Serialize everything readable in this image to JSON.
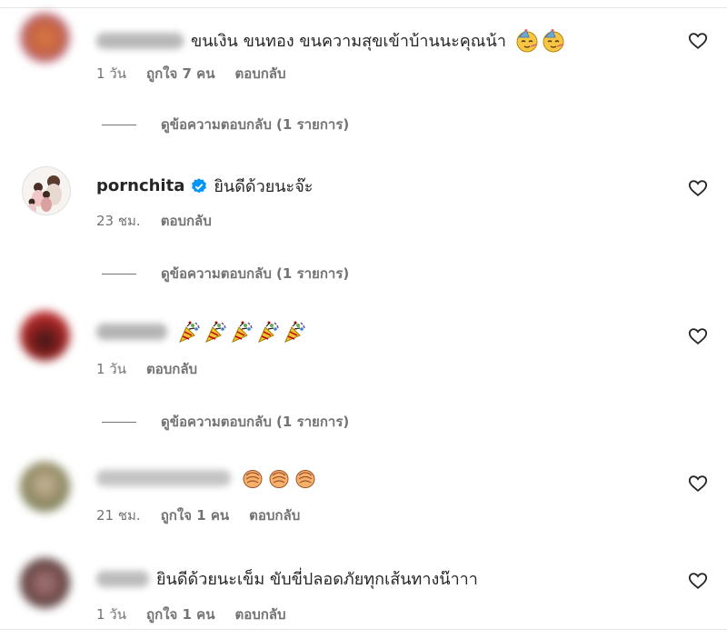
{
  "comments": [
    {
      "username": "",
      "username_hidden": true,
      "text": "ขนเงิน ขนทอง ขนความสุขเข้าบ้านนะคุณน้า",
      "emojis": [
        "face-with-party-hat-emoji",
        "face-with-party-hat-emoji"
      ],
      "time": "1 วัน",
      "likes": "ถูกใจ 7 คน",
      "reply": "ตอบกลับ",
      "view_replies": "ดูข้อความตอบกลับ (1 รายการ)"
    },
    {
      "username": "pornchita",
      "username_hidden": false,
      "verified": true,
      "text": "ยินดีด้วยนะจ๊ะ",
      "time": "23 ชม.",
      "reply": "ตอบกลับ",
      "view_replies": "ดูข้อความตอบกลับ (1 รายการ)"
    },
    {
      "username": "",
      "username_hidden": true,
      "text": "",
      "emojis": [
        "party-popper-emoji",
        "party-popper-emoji",
        "party-popper-emoji",
        "party-popper-emoji",
        "party-popper-emoji"
      ],
      "time": "1 วัน",
      "reply": "ตอบกลับ",
      "view_replies": "ดูข้อความตอบกลับ (1 รายการ)"
    },
    {
      "username": "",
      "username_hidden": true,
      "text": "",
      "emojis": [
        "clapping-hands-emoji",
        "clapping-hands-emoji",
        "clapping-hands-emoji"
      ],
      "time": "21 ชม.",
      "likes": "ถูกใจ 1 คน",
      "reply": "ตอบกลับ"
    },
    {
      "username": "",
      "username_hidden": true,
      "text": "ยินดีด้วยนะเข็ม ขับขี่ปลอดภัยทุกเส้นทางน๊าาา",
      "time": "1 วัน",
      "likes": "ถูกใจ 1 คน",
      "reply": "ตอบกลับ"
    }
  ],
  "colors": {
    "text": "#262626",
    "secondary": "#737373",
    "verified_blue": "#0095f6",
    "divider": "#e6e6e6"
  }
}
